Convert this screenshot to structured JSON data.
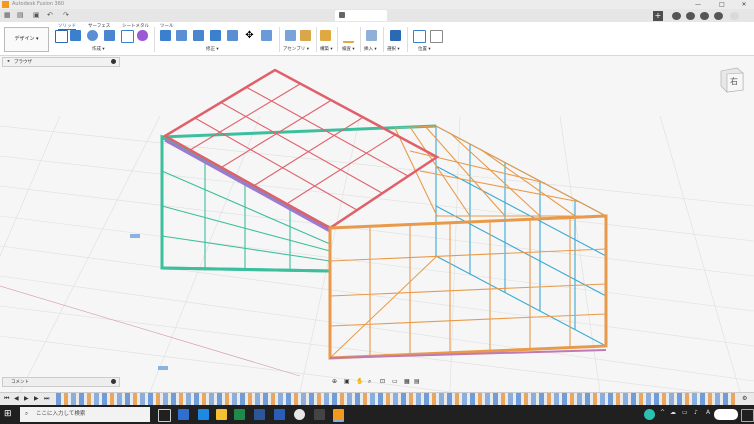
{
  "window": {
    "title": "Autodesk Fusion 360",
    "minimize_glyph": "—",
    "maximize_glyph": "□",
    "close_glyph": "✕"
  },
  "quick_access": {
    "grid_glyph": "▦",
    "file_glyph": "▤",
    "save_glyph": "▣",
    "undo_glyph": "↶",
    "redo_glyph": "↷",
    "new_tab_glyph": "+"
  },
  "ribbon": {
    "tabs": [
      "ソリッド",
      "サーフェス",
      "シートメタル",
      "ツール"
    ],
    "active_tab": "ソリッド",
    "workspace_label": "デザイン ▾",
    "groups": [
      "作成 ▾",
      "修正 ▾",
      "アセンブリ ▾",
      "構築 ▾",
      "検査 ▾",
      "挿入 ▾",
      "選択 ▾",
      "位置 ▾"
    ]
  },
  "browser": {
    "label": "ブラウザ"
  },
  "comments": {
    "label": "コメント"
  },
  "viewcube": {
    "face_label": "右"
  },
  "colors": {
    "roof": "#e0606a",
    "back_frame": "#3dbf9e",
    "front_frame": "#e89a4a",
    "right_panel": "#3aa9d6",
    "grid_line": "#dcdcdc",
    "accent": "#2a6ab5"
  },
  "taskbar": {
    "search_placeholder": "ここに入力して検索",
    "ime_label": "A"
  }
}
